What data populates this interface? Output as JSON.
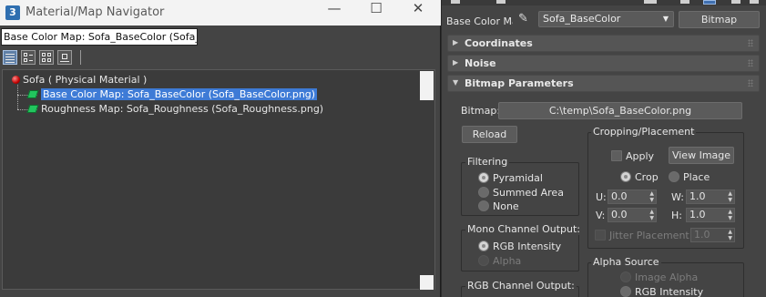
{
  "window": {
    "app_icon": "3",
    "title": "Material/Map Navigator",
    "controls": {
      "minimize": "—",
      "maximize": "☐",
      "close": "✕"
    }
  },
  "path_field": {
    "value": "Base Color Map: Sofa_BaseColor (Sofa_Base"
  },
  "toolbar": {
    "buttons": [
      {
        "icon": "list-view-icon",
        "active": true
      },
      {
        "icon": "list-thumb-small-icon",
        "active": false
      },
      {
        "icon": "list-thumb-large-icon",
        "active": false
      },
      {
        "icon": "show-maps-icon",
        "active": false
      }
    ]
  },
  "tree": {
    "root": {
      "label": "Sofa  ( Physical Material )"
    },
    "children": [
      {
        "label": "Base Color Map: Sofa_BaseColor (Sofa_BaseColor.png)",
        "selected": true
      },
      {
        "label": "Roughness Map: Sofa_Roughness (Sofa_Roughness.png)",
        "selected": false
      }
    ]
  },
  "editor": {
    "map_label": "Base Color Map",
    "map_name": "Sofa_BaseColor",
    "map_type_button": "Bitmap",
    "rollouts": {
      "coordinates": "Coordinates",
      "noise": "Noise",
      "bitmap_parameters": "Bitmap Parameters"
    },
    "bitmap_label": "Bitmap:",
    "bitmap_path": "C:\\temp\\Sofa_BaseColor.png",
    "reload_button": "Reload",
    "filtering": {
      "title": "Filtering",
      "options": [
        "Pyramidal",
        "Summed Area",
        "None"
      ],
      "selected": "Pyramidal"
    },
    "mono_channel": {
      "title": "Mono Channel Output:",
      "options": [
        "RGB Intensity",
        "Alpha"
      ],
      "selected": "RGB Intensity"
    },
    "rgb_channel": {
      "title": "RGB Channel Output:"
    },
    "cropping": {
      "title": "Cropping/Placement",
      "apply_label": "Apply",
      "view_image_button": "View Image",
      "crop_label": "Crop",
      "place_label": "Place",
      "mode": "Crop",
      "u_label": "U:",
      "u_value": "0.0",
      "v_label": "V:",
      "v_value": "0.0",
      "w_label": "W:",
      "w_value": "1.0",
      "h_label": "H:",
      "h_value": "1.0",
      "jitter_label": "Jitter Placement:",
      "jitter_value": "1.0"
    },
    "alpha_source": {
      "title": "Alpha Source",
      "options": [
        "Image Alpha",
        "RGB Intensity"
      ]
    }
  },
  "colors": {
    "selection": "#3e7bd6",
    "panel_bg": "#444444",
    "title_bar": "#f3f3f3",
    "map_icon": "#22c55e",
    "material_icon": "#c00000"
  }
}
